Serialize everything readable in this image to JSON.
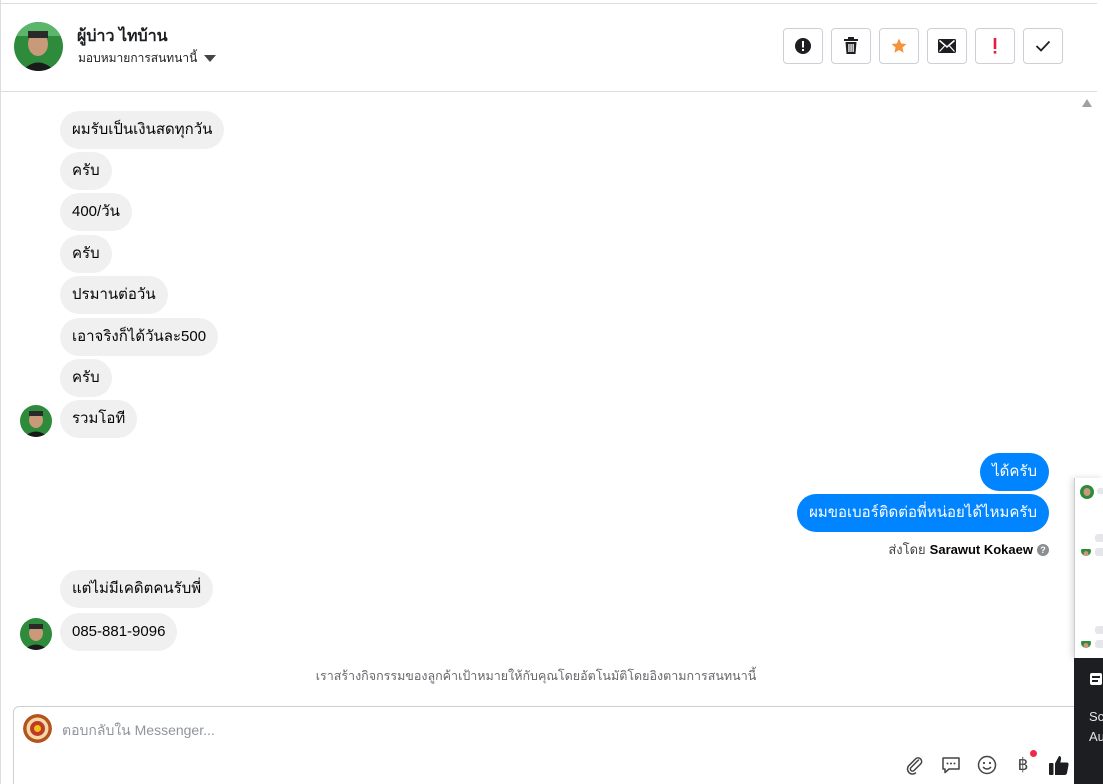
{
  "header": {
    "contact_name": "ผู้บ่าว ไทบ้าน",
    "assign_label": "มอบหมายการสนทนานี้",
    "toolbar": [
      {
        "name": "report-spam-button",
        "icon": "alert-circle-icon"
      },
      {
        "name": "delete-button",
        "icon": "trash-icon"
      },
      {
        "name": "star-button",
        "icon": "star-icon"
      },
      {
        "name": "mark-unread-button",
        "icon": "envelope-icon"
      },
      {
        "name": "follow-up-button",
        "icon": "exclamation-icon"
      },
      {
        "name": "mark-done-button",
        "icon": "check-icon"
      }
    ]
  },
  "messages": {
    "incoming_1": [
      "ผมรับเป็นเงินสดทุกวัน",
      "ครับ",
      "400/วัน",
      "ครับ",
      "ปรมานต่อวัน",
      "เอาจริงก็ได้วันละ500",
      "ครับ",
      "รวมโอที"
    ],
    "outgoing": [
      "ได้ครับ",
      "ผมขอเบอร์ติดต่อพี่หน่อยได้ไหมครับ"
    ],
    "sent_by_prefix": "ส่งโดย",
    "sent_by_name": "Sarawut Kokaew",
    "incoming_2": [
      "แต่ไม่มีเคดิตคนรับพี่",
      "085-881-9096"
    ]
  },
  "notice": "เราสร้างกิจกรรมของลูกค้าเป้าหมายให้กับคุณโดยอัตโนมัติโดยอิงตามการสนทนานี้",
  "composer": {
    "placeholder": "ตอบกลับใน Messenger...",
    "value": "",
    "tools": [
      "paperclip-icon",
      "saved-replies-icon",
      "emoji-icon",
      "baht-payment-icon",
      "thumbs-up-icon"
    ],
    "baht_symbol": "฿"
  },
  "side_panel": {
    "dark_lines": [
      "Sc",
      "Au"
    ]
  },
  "colors": {
    "outgoing_bubble": "#0084ff",
    "incoming_bubble": "#f0f0f0",
    "star": "#f7923b",
    "alert_red": "#e41e3f"
  }
}
